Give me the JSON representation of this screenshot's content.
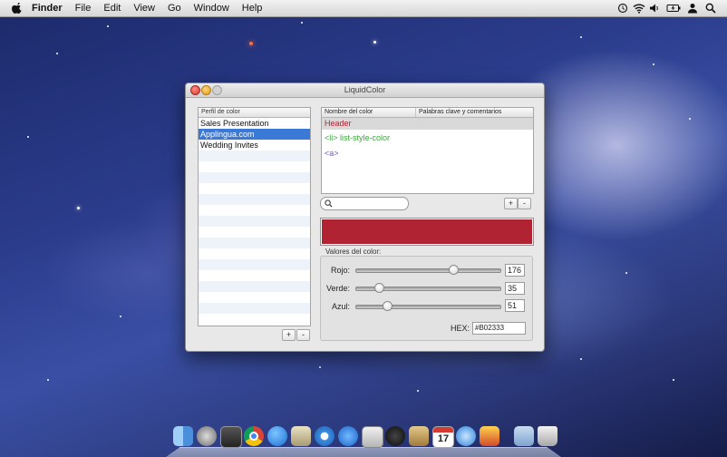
{
  "menubar": {
    "app": "Finder",
    "items": [
      "File",
      "Edit",
      "View",
      "Go",
      "Window",
      "Help"
    ]
  },
  "window": {
    "title": "LiquidColor",
    "profiles": {
      "header": "Perfil de color",
      "items": [
        "Sales Presentation",
        "Applingua.com",
        "Wedding Invites"
      ],
      "selected_index": 1
    },
    "names_table": {
      "col1": "Nombre del color",
      "col2": "Palabras clave y comentarios",
      "rows": [
        {
          "label": "Header",
          "color": "#b02333"
        },
        {
          "label": "<li> list-style-color",
          "color": "#3fa43f"
        },
        {
          "label": "<a>",
          "color": "#7755cc"
        }
      ],
      "selected_index": 0
    },
    "search": {
      "placeholder": ""
    },
    "add_label": "+",
    "remove_label": "-",
    "swatch_color": "#B02333",
    "values_group": {
      "label": "Valores del color:",
      "red": {
        "label": "Rojo:",
        "value": "176",
        "fraction": 0.69
      },
      "green": {
        "label": "Verde:",
        "value": "35",
        "fraction": 0.14
      },
      "blue": {
        "label": "Azul:",
        "value": "51",
        "fraction": 0.2
      },
      "hex_label": "HEX:",
      "hex_value": "#B02333"
    }
  },
  "dock": {
    "icons": [
      "finder-icon",
      "launchpad-icon",
      "activity-monitor-icon",
      "chrome-icon",
      "app-store-icon",
      "preview-icon",
      "safari-icon",
      "facetime-icon",
      "photo-booth-icon",
      "quicktime-icon",
      "contacts-icon",
      "calendar-icon",
      "itunes-icon",
      "photo-icon",
      "downloads-folder-icon",
      "trash-icon"
    ],
    "calendar_day": "17"
  }
}
